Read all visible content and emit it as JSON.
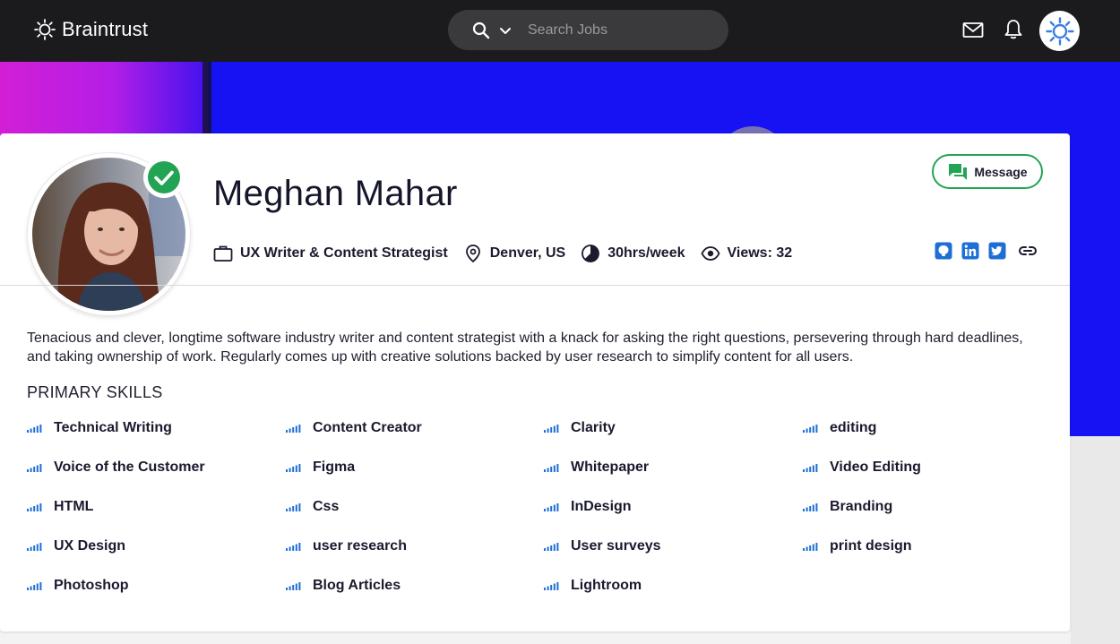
{
  "app": {
    "brand": "Braintrust",
    "search_placeholder": "Search Jobs"
  },
  "profile": {
    "name": "Meghan Mahar",
    "title": "UX Writer & Content Strategist",
    "location": "Denver, US",
    "availability": "30hrs/week",
    "views": "Views: 32",
    "message_label": "Message",
    "bio": "Tenacious and clever, longtime software industry writer and content strategist with a knack for asking the right questions, persevering through hard deadlines, and taking ownership of work. Regularly comes up with creative solutions backed by user research to simplify content for all users.",
    "skills_heading": "PRIMARY SKILLS"
  },
  "skills": [
    [
      "Technical Writing",
      "Content Creator",
      "Clarity",
      "editing"
    ],
    [
      "Voice of the Customer",
      "Figma",
      "Whitepaper",
      "Video Editing"
    ],
    [
      "HTML",
      "Css",
      "InDesign",
      "Branding"
    ],
    [
      "UX Design",
      "user research",
      "User surveys",
      "print design"
    ],
    [
      "Photoshop",
      "Blog Articles",
      "Lightroom"
    ]
  ],
  "colors": {
    "accent_green": "#23a455",
    "link_blue": "#1d6fd6",
    "banner_blue": "#1612f4"
  }
}
